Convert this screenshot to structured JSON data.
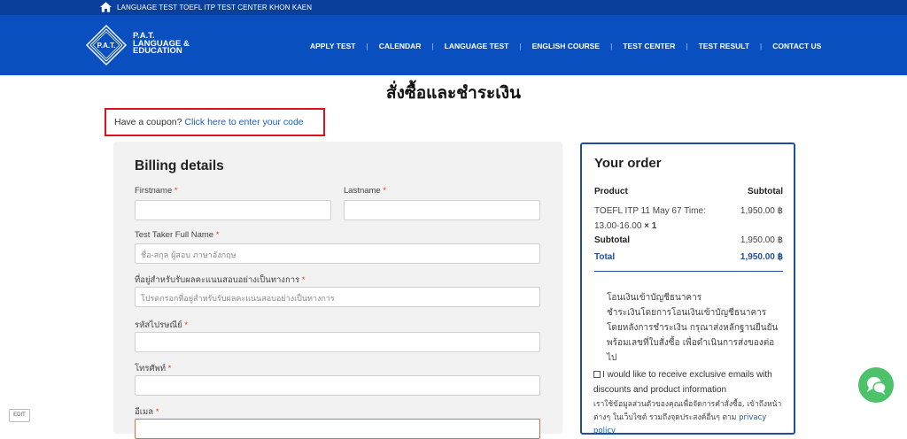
{
  "topbar": {
    "text": "LANGUAGE TEST TOEFL ITP TEST CENTER KHON KAEN",
    "icon": "home-icon"
  },
  "brand": {
    "logo_text": "P.A.T.",
    "line1": "P.A.T.",
    "line2": "LANGUAGE &",
    "line3": "EDUCATION"
  },
  "nav": {
    "items": [
      "APPLY TEST",
      "CALENDAR",
      "LANGUAGE TEST",
      "ENGLISH COURSE",
      "TEST CENTER",
      "TEST RESULT",
      "CONTACT US"
    ],
    "separator": "|"
  },
  "page_title": "สั่งซื้อและชำระเงิน",
  "coupon": {
    "text": "Have a coupon?",
    "link": "Click here to enter your code"
  },
  "billing": {
    "title": "Billing details",
    "firstname_label": "Firstname",
    "lastname_label": "Lastname",
    "fullname_label": "Test Taker Full Name",
    "fullname_placeholder": "ชื่อ-สกุล ผู้สอบ ภาษาอังกฤษ",
    "address_label": "ที่อยู่สำหรับรับผลคะแนนสอบอย่างเป็นทางการ",
    "address_placeholder": "โปรดกรอกที่อยู่สำหรับรับผลคะแนนสอบอย่างเป็นทางการ",
    "postcode_label": "รหัสไปรษณีย์",
    "phone_label": "โทรศัพท์",
    "email_label": "อีเมล",
    "required": "*"
  },
  "order": {
    "title": "Your order",
    "col_product": "Product",
    "col_subtotal": "Subtotal",
    "item_name": "TOEFL ITP 11 May 67 Time:",
    "item_name2": "13.00-16.00",
    "item_qty": "× 1",
    "item_price": "1,950.00 ฿",
    "subtotal_label": "Subtotal",
    "subtotal_value": "1,950.00 ฿",
    "total_label": "Total",
    "total_value": "1,950.00 ฿",
    "bank_title": "โอนเงินเข้าบัญชีธนาคาร",
    "bank_desc": "ชำระเงินโดยการโอนเงินเข้าบัญชีธนาคาร โดยหลังการชำระเงิน กรุณาส่งหลักฐานยืนยันพร้อมเลขที่ใบสั่งซื้อ เพื่อดำเนินการส่งของต่อไป",
    "consent": "I would like to receive exclusive emails with discounts and product information",
    "privacy_text": "เราใช้ข้อมูลส่วนตัวของคุณเพื่อจัดการคำสั่งซื้อ, เข้าถึงหน้าต่างๆ ในเว็บไซต์ รวมถึงจุดประสงค์อื่นๆ ตาม",
    "privacy_link": "privacy policy"
  },
  "edit_label": "EDIT",
  "colors": {
    "nav": "#0a4fc0",
    "topbar": "#0a3f9c",
    "accent": "#1e4f9c",
    "chat": "#4cc36a",
    "highlight": "#e0101e"
  }
}
